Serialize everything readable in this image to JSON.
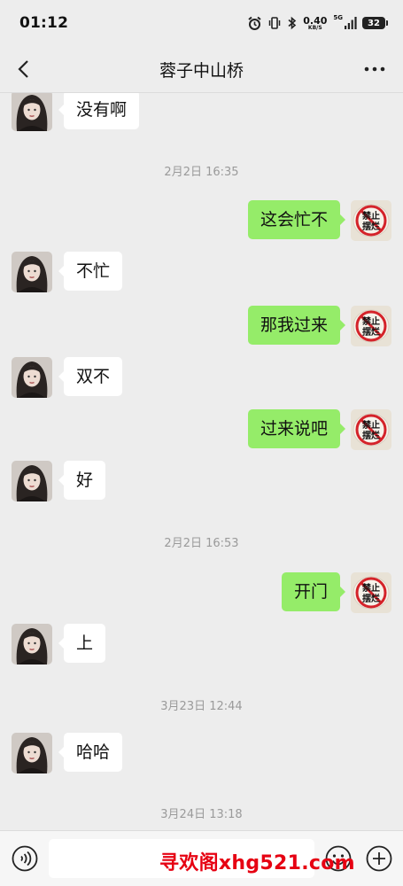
{
  "status_bar": {
    "time": "01:12",
    "net_speed": "0.40",
    "net_speed_unit": "KB/S",
    "network": "5G",
    "battery": "32"
  },
  "nav": {
    "title": "蓉子中山桥",
    "back_icon": "chevron-left-icon",
    "more_icon": "more-dots-icon"
  },
  "messages": [
    {
      "type": "in",
      "text": "没有啊"
    },
    {
      "type": "time",
      "text": "2月2日 16:35"
    },
    {
      "type": "out",
      "text": "这会忙不"
    },
    {
      "type": "in",
      "text": "不忙"
    },
    {
      "type": "out",
      "text": "那我过来"
    },
    {
      "type": "in",
      "text": "双不"
    },
    {
      "type": "out",
      "text": "过来说吧"
    },
    {
      "type": "in",
      "text": "好"
    },
    {
      "type": "time",
      "text": "2月2日 16:53"
    },
    {
      "type": "out",
      "text": "开门"
    },
    {
      "type": "in",
      "text": "上"
    },
    {
      "type": "time",
      "text": "3月23日 12:44"
    },
    {
      "type": "in",
      "text": "哈哈"
    },
    {
      "type": "time",
      "text": "3月24日 13:18"
    }
  ],
  "input_bar": {
    "placeholder": "",
    "voice_icon": "voice-icon",
    "emoji_icon": "emoji-icon",
    "plus_icon": "plus-icon"
  },
  "watermark": "寻欢阁xhg521.com",
  "my_avatar_text": "禁止摆烂",
  "colors": {
    "background": "#ededed",
    "outgoing_bubble": "#95ec69",
    "incoming_bubble": "#ffffff",
    "timestamp": "#9a9a9a",
    "watermark": "#e60012"
  }
}
